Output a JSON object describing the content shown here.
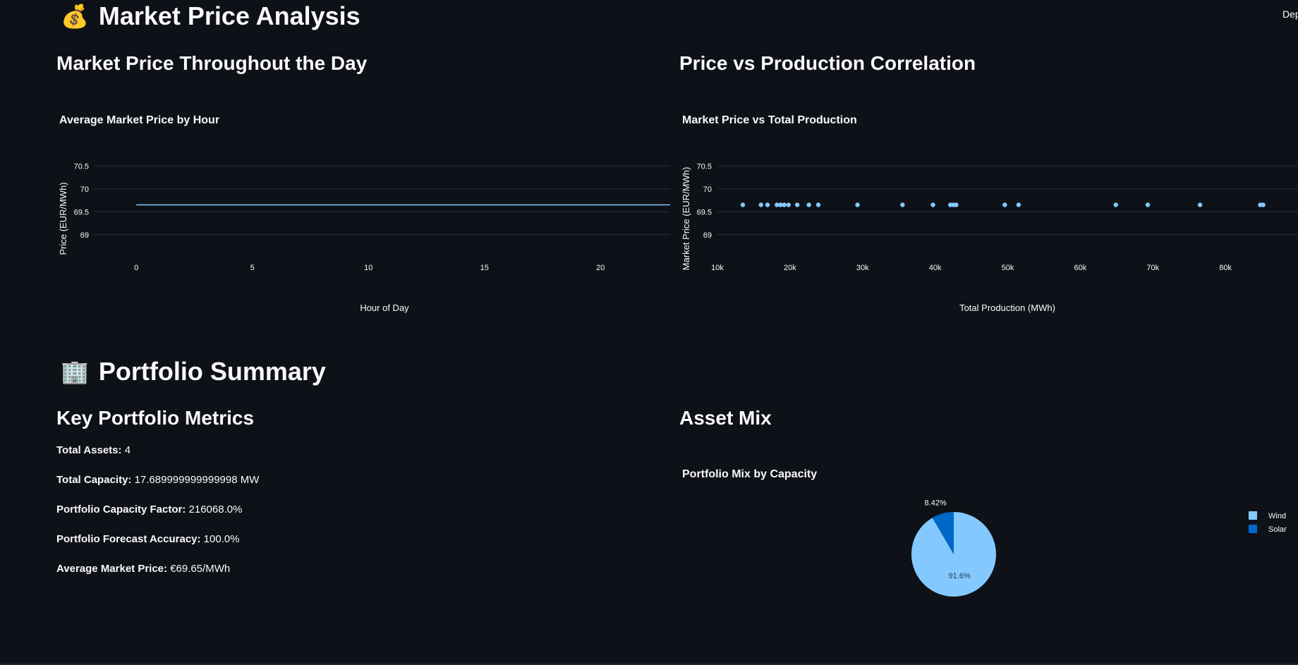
{
  "header": {
    "deploy_label": "Dep"
  },
  "market_section": {
    "title_icon": "💰",
    "title": "Market Price Analysis",
    "left_subheader": "Market Price Throughout the Day",
    "right_subheader": "Price vs Production Correlation"
  },
  "portfolio_section": {
    "title_icon": "🏢",
    "title": "Portfolio Summary",
    "left_subheader": "Key Portfolio Metrics",
    "right_subheader": "Asset Mix"
  },
  "metrics": [
    {
      "label": "Total Assets:",
      "value": " 4"
    },
    {
      "label": "Total Capacity:",
      "value": " 17.689999999999998 MW"
    },
    {
      "label": "Portfolio Capacity Factor:",
      "value": " 216068.0%"
    },
    {
      "label": "Portfolio Forecast Accuracy:",
      "value": " 100.0%"
    },
    {
      "label": "Average Market Price:",
      "value": " €69.65/MWh"
    }
  ],
  "colors": {
    "background": "#0e1117",
    "text": "#fafafa",
    "gridline": "#31333f",
    "light_blue": "#83c9ff",
    "dark_blue": "#0068c9"
  },
  "chart_data": [
    {
      "type": "line",
      "title": "Average Market Price by Hour",
      "xlabel": "Hour of Day",
      "ylabel": "Price (EUR/MWh)",
      "xlim": [
        -1.8,
        23
      ],
      "ylim": [
        68.75,
        70.75
      ],
      "xticks": [
        0,
        5,
        10,
        15,
        20
      ],
      "xtick_labels": [
        "0",
        "5",
        "10",
        "15",
        "20"
      ],
      "yticks": [
        69,
        69.5,
        70,
        70.5
      ],
      "ytick_labels": [
        "69",
        "69.5",
        "70",
        "70.5"
      ],
      "grid": true,
      "series": [
        {
          "x": [
            0,
            1,
            2,
            3,
            4,
            5,
            6,
            7,
            8,
            9,
            10,
            11,
            12,
            13,
            14,
            15,
            16,
            17,
            18,
            19,
            20,
            21,
            22,
            23
          ],
          "y": [
            69.65,
            69.65,
            69.65,
            69.65,
            69.65,
            69.65,
            69.65,
            69.65,
            69.65,
            69.65,
            69.65,
            69.65,
            69.65,
            69.65,
            69.65,
            69.65,
            69.65,
            69.65,
            69.65,
            69.65,
            69.65,
            69.65,
            69.65,
            69.65
          ]
        }
      ]
    },
    {
      "type": "scatter",
      "title": "Market Price vs Total Production",
      "xlabel": "Total Production (MWh)",
      "ylabel": "Market Price (EUR/MWh)",
      "xlim": [
        10000,
        90000
      ],
      "ylim": [
        68.75,
        70.75
      ],
      "xticks": [
        10000,
        20000,
        30000,
        40000,
        50000,
        60000,
        70000,
        80000
      ],
      "xtick_labels": [
        "10k",
        "20k",
        "30k",
        "40k",
        "50k",
        "60k",
        "70k",
        "80k"
      ],
      "yticks": [
        69,
        69.5,
        70,
        70.5
      ],
      "ytick_labels": [
        "69",
        "69.5",
        "70",
        "70.5"
      ],
      "grid": true,
      "series": [
        {
          "x": [
            13500,
            16000,
            16900,
            18200,
            18700,
            19200,
            19800,
            21000,
            22600,
            23900,
            29300,
            35500,
            39700,
            42100,
            42500,
            42900,
            49600,
            51500,
            64900,
            69300,
            76500,
            84800,
            85200
          ],
          "y": [
            69.65,
            69.65,
            69.65,
            69.65,
            69.65,
            69.65,
            69.65,
            69.65,
            69.65,
            69.65,
            69.65,
            69.65,
            69.65,
            69.65,
            69.65,
            69.65,
            69.65,
            69.65,
            69.65,
            69.65,
            69.65,
            69.65,
            69.65
          ]
        }
      ]
    },
    {
      "type": "pie",
      "title": "Portfolio Mix by Capacity",
      "legend_position": "right",
      "slices": [
        {
          "name": "Wind",
          "value": 91.6,
          "label": "91.6%",
          "color": "#83c9ff"
        },
        {
          "name": "Solar",
          "value": 8.42,
          "label": "8.42%",
          "color": "#0068c9"
        }
      ]
    }
  ]
}
